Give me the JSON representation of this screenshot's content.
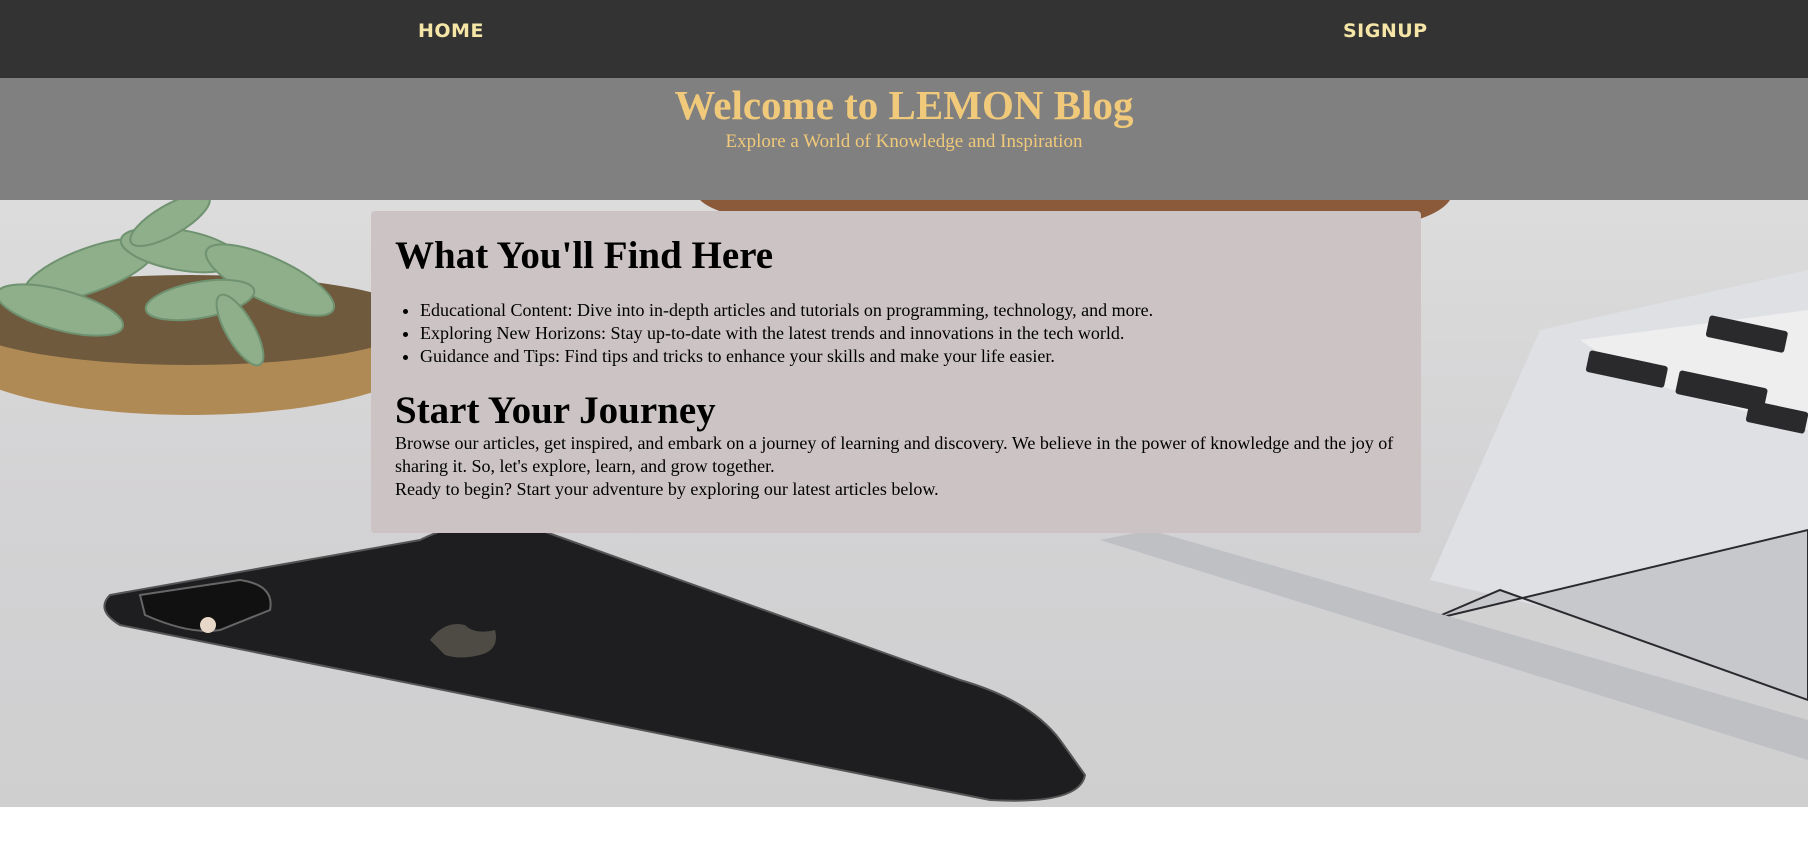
{
  "nav": {
    "home_label": "HOME",
    "signup_label": "SIGNUP"
  },
  "header": {
    "title": "Welcome to LEMON Blog",
    "subtitle": "Explore a World of Knowledge and Inspiration"
  },
  "content": {
    "find_heading": "What You'll Find Here",
    "items": [
      "Educational Content: Dive into in-depth articles and tutorials on programming, technology, and more.",
      "Exploring New Horizons: Stay up-to-date with the latest trends and innovations in the tech world.",
      "Guidance and Tips: Find tips and tricks to enhance your skills and make your life easier."
    ],
    "journey_heading": "Start Your Journey",
    "journey_text_1": "Browse our articles, get inspired, and embark on a journey of learning and discovery. We believe in the power of knowledge and the joy of sharing it. So, let's explore, learn, and grow together.",
    "journey_text_2": "Ready to begin? Start your adventure by exploring our latest articles below."
  },
  "colors": {
    "nav_bg": "#333333",
    "nav_text": "#f5e6a8",
    "header_bg": "#808080",
    "header_text": "#f0c97a",
    "card_bg": "#cbc3c4"
  }
}
